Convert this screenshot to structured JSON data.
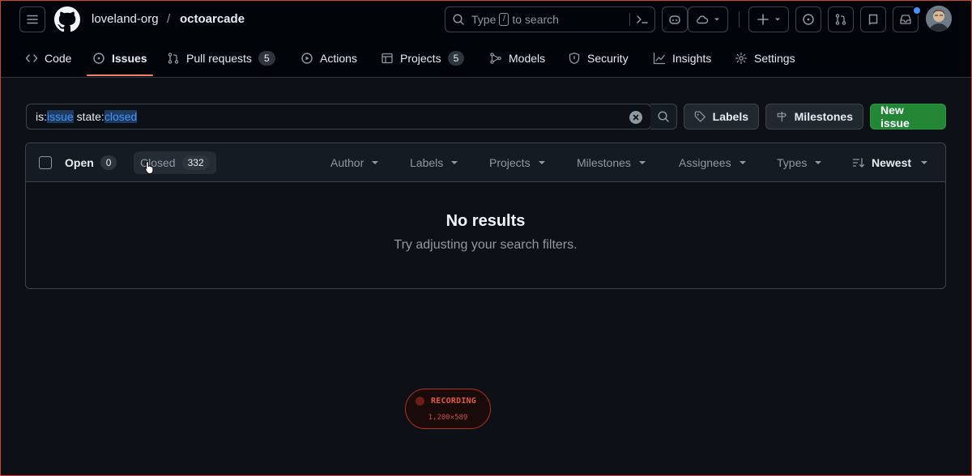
{
  "header": {
    "owner": "loveland-org",
    "separator": "/",
    "repo": "octoarcade",
    "search": {
      "prefix": "Type",
      "kbd": "/",
      "suffix": "to search"
    }
  },
  "tabs": [
    {
      "label": "Code",
      "icon": "code-icon"
    },
    {
      "label": "Issues",
      "icon": "issue-opened-icon",
      "active": true
    },
    {
      "label": "Pull requests",
      "icon": "git-pull-request-icon",
      "count": "5"
    },
    {
      "label": "Actions",
      "icon": "play-icon"
    },
    {
      "label": "Projects",
      "icon": "table-icon",
      "count": "5"
    },
    {
      "label": "Models",
      "icon": "models-icon"
    },
    {
      "label": "Security",
      "icon": "shield-icon"
    },
    {
      "label": "Insights",
      "icon": "graph-icon"
    },
    {
      "label": "Settings",
      "icon": "gear-icon"
    }
  ],
  "toolbar": {
    "filter": {
      "k1": "is:",
      "v1": "issue",
      "k2": " state:",
      "v2": "closed"
    },
    "labels_button": "Labels",
    "milestones_button": "Milestones",
    "new_issue_button": "New issue"
  },
  "list": {
    "open_label": "Open",
    "open_count": "0",
    "closed_label": "Closed",
    "closed_count": "332",
    "filters": [
      "Author",
      "Labels",
      "Projects",
      "Milestones",
      "Assignees",
      "Types"
    ],
    "sort_label": "Newest",
    "empty_title": "No results",
    "empty_subtitle": "Try adjusting your search filters."
  },
  "recording": {
    "label": "RECORDING",
    "dims": "1,200×589"
  },
  "colors": {
    "accent_tab": "#f78166",
    "primary_button": "#238636",
    "link": "#4493f8",
    "notification": "#4493f8"
  }
}
